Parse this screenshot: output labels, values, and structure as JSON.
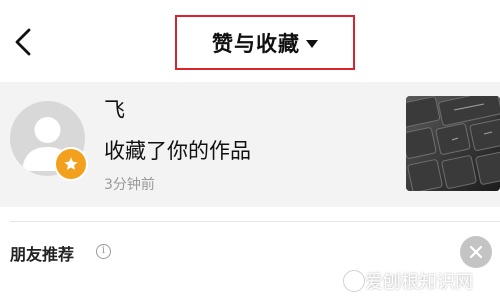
{
  "header": {
    "title": "赞与收藏",
    "back_icon": "chevron-left-icon",
    "dropdown_icon": "caret-down-icon",
    "highlight_color": "#d9232f"
  },
  "notification": {
    "user_name": "飞",
    "action": "收藏了你的作品",
    "time": "3分钟前",
    "avatar_icon": "default-user-icon",
    "badge_icon": "star-icon",
    "badge_color": "#f3a01c",
    "thumbnail_icon": "keyboard-photo"
  },
  "friends": {
    "label": "朋友推荐",
    "info_icon": "info-icon",
    "info_glyph": "i",
    "close_icon": "close-icon"
  },
  "watermark": {
    "text": "爱刨根知识网"
  }
}
